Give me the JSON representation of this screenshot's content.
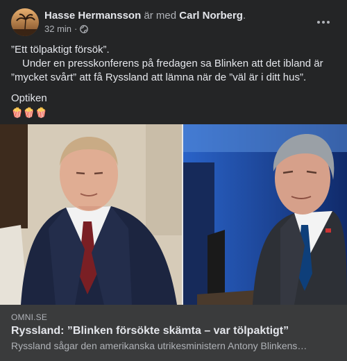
{
  "post": {
    "author": "Hasse Hermansson",
    "with_text": "är med",
    "tagged": "Carl Norberg",
    "tagged_suffix": ".",
    "time": "32 min",
    "time_sep": "·",
    "audience_icon": "globe-icon",
    "more_icon": "more-options-icon"
  },
  "body": {
    "line1": "”Ett tölpaktigt försök”.",
    "line2": "Under en presskonferens på fredagen sa Blinken att det ibland är ”mycket svårt” att få Ryssland att lämna när de ”väl är i ditt hus”.",
    "line3": "Optiken",
    "emojis": "🍿🍿🍿"
  },
  "link_preview": {
    "domain": "OMNI.SE",
    "headline": "Ryssland: ”Blinken försökte skämta – var tölpaktigt”",
    "description": "Ryssland sågar den amerikanska utrikesministern Antony Blinkens…"
  },
  "colors": {
    "background": "#242526",
    "link_box": "#3a3b3c",
    "primary_text": "#e4e6eb",
    "secondary_text": "#b0b3b8"
  }
}
